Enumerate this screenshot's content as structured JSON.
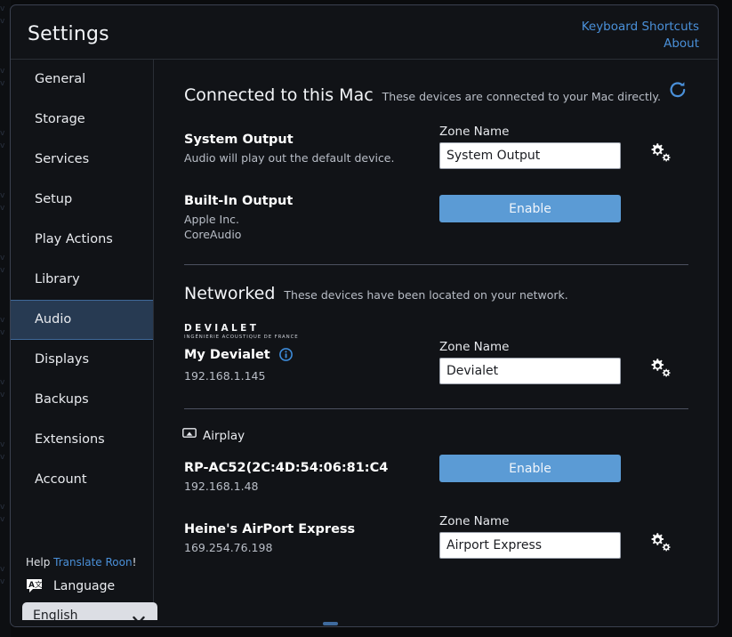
{
  "window": {
    "title": "Settings"
  },
  "header": {
    "links": [
      {
        "label": "Keyboard Shortcuts",
        "name": "keyboard-shortcuts-link"
      },
      {
        "label": "About",
        "name": "about-link"
      }
    ]
  },
  "sidebar": {
    "items": [
      {
        "label": "General",
        "active": false
      },
      {
        "label": "Storage",
        "active": false
      },
      {
        "label": "Services",
        "active": false
      },
      {
        "label": "Setup",
        "active": false
      },
      {
        "label": "Play Actions",
        "active": false
      },
      {
        "label": "Library",
        "active": false
      },
      {
        "label": "Audio",
        "active": true
      },
      {
        "label": "Displays",
        "active": false
      },
      {
        "label": "Backups",
        "active": false
      },
      {
        "label": "Extensions",
        "active": false
      },
      {
        "label": "Account",
        "active": false
      }
    ],
    "footer": {
      "help_prefix": "Help ",
      "help_link": "Translate Roon",
      "help_suffix": "!",
      "language_label": "Language",
      "language_icon": "language-icon",
      "language_value": "English",
      "language_options": [
        "English"
      ]
    }
  },
  "main": {
    "sections": [
      {
        "title": "Connected to this Mac",
        "subtitle": "These devices are connected to your Mac directly.",
        "refresh_icon": "refresh-icon",
        "devices": [
          {
            "name": "System Output",
            "description": "Audio will play out the default device.",
            "control": "zone",
            "zone_label": "Zone Name",
            "zone_value": "System Output",
            "zone_placeholder": "Zone Name",
            "gear": true
          },
          {
            "name": "Built-In Output",
            "description_lines": [
              "Apple Inc.",
              "CoreAudio"
            ],
            "control": "enable",
            "enable_label": "Enable",
            "gear": false
          }
        ]
      },
      {
        "title": "Networked",
        "subtitle": "These devices have been located on your network.",
        "brand": {
          "name": "DEVIALET",
          "tagline": "INGÉNIERIE ACOUSTIQUE DE FRANCE"
        },
        "devices": [
          {
            "name": "My Devialet",
            "info_icon": "info-icon",
            "description": "192.168.1.145",
            "control": "zone",
            "zone_label": "Zone Name",
            "zone_value": "Devialet",
            "zone_placeholder": "Zone Name",
            "gear": true
          }
        ]
      },
      {
        "group_icon": "airplay-icon",
        "group_label": "Airplay",
        "devices": [
          {
            "name": "RP-AC52(2C:4D:54:06:81:C4",
            "description": "192.168.1.48",
            "control": "enable",
            "enable_label": "Enable",
            "gear": false
          },
          {
            "name": "Heine's AirPort Express",
            "description": "169.254.76.198",
            "control": "zone",
            "zone_label": "Zone Name",
            "zone_value": "Airport Express",
            "zone_placeholder": "Zone Name",
            "gear": true
          }
        ]
      }
    ]
  },
  "colors": {
    "accent_blue": "#4a90d9",
    "button_blue": "#5b9bd5",
    "active_nav_bg": "#273a52",
    "window_bg": "#111317",
    "text_primary": "#f2f4f7",
    "text_secondary": "#b9bec7"
  }
}
